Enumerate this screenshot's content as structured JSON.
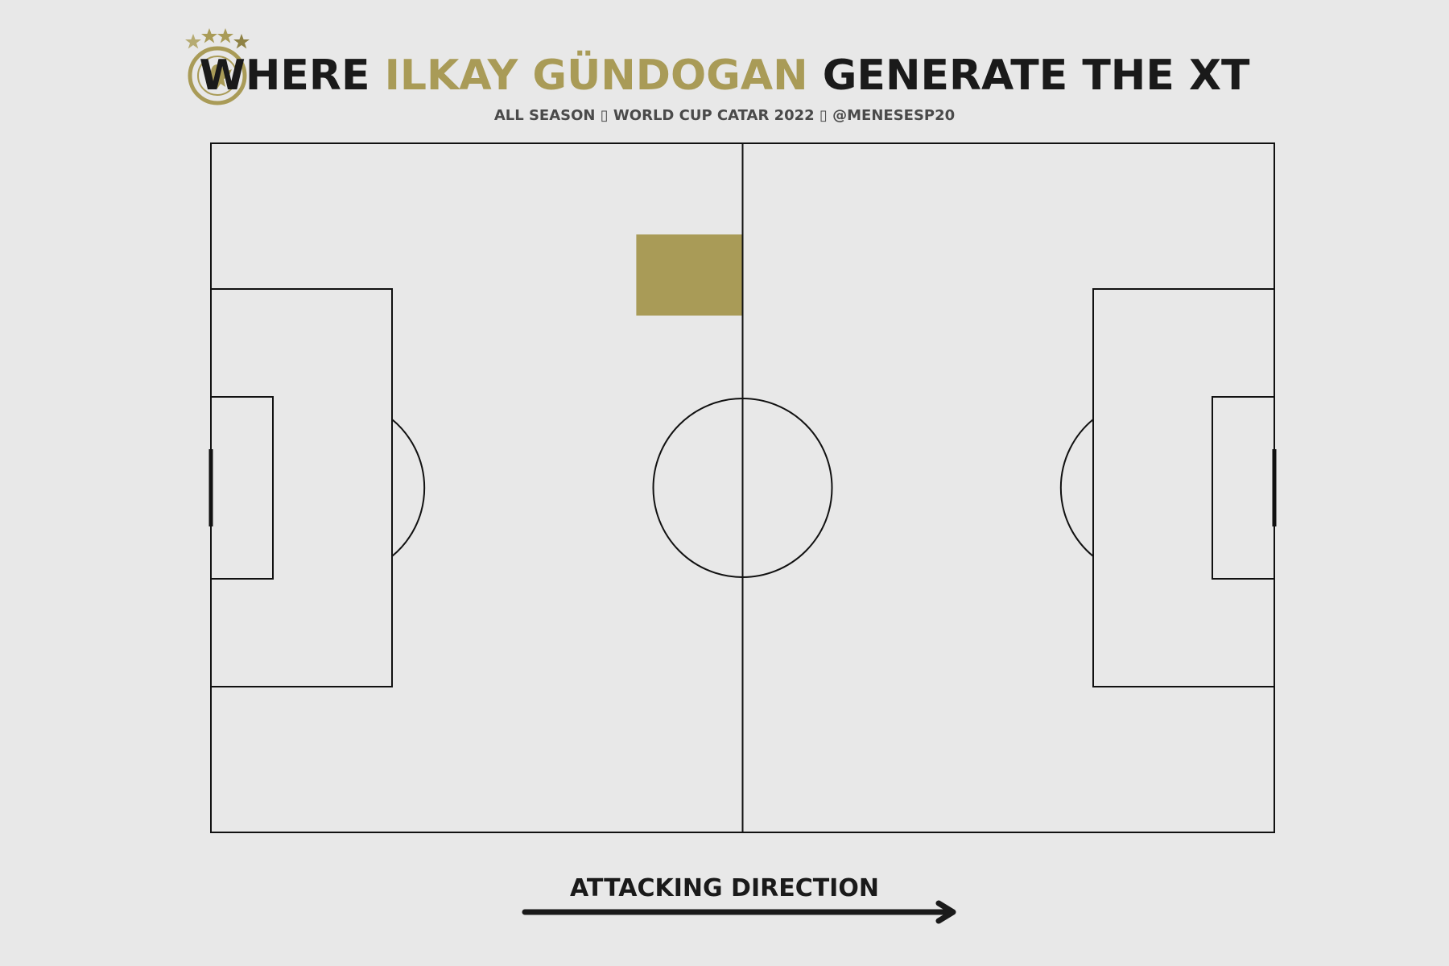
{
  "header": {
    "title_prefix": "WHERE",
    "player_name": "ILKAY GÜNDOGAN",
    "title_suffix": "GENERATE THE XT",
    "subtitle": "ALL SEASON ▯ WORLD CUP CATAR 2022 ▯ @MENESESP20",
    "logo_icon": "dfb-crest-icon"
  },
  "footer": {
    "direction_label": "ATTACKING DIRECTION",
    "arrow_icon": "arrow-right-icon"
  },
  "colors": {
    "background": "#e8e8e8",
    "accent": "#a99b57",
    "lines": "#111111",
    "title": "#1a1a1a",
    "subtitle": "#4a4a4a"
  },
  "chart_data": {
    "type": "heatmap",
    "pitch": {
      "length": 105,
      "width": 68,
      "direction": "left-to-right"
    },
    "xlim": [
      0,
      105
    ],
    "ylim": [
      0,
      68
    ],
    "cells": [
      {
        "x": [
          42,
          52.5
        ],
        "y": [
          51,
          59
        ],
        "value": 1
      }
    ],
    "grid": false
  }
}
